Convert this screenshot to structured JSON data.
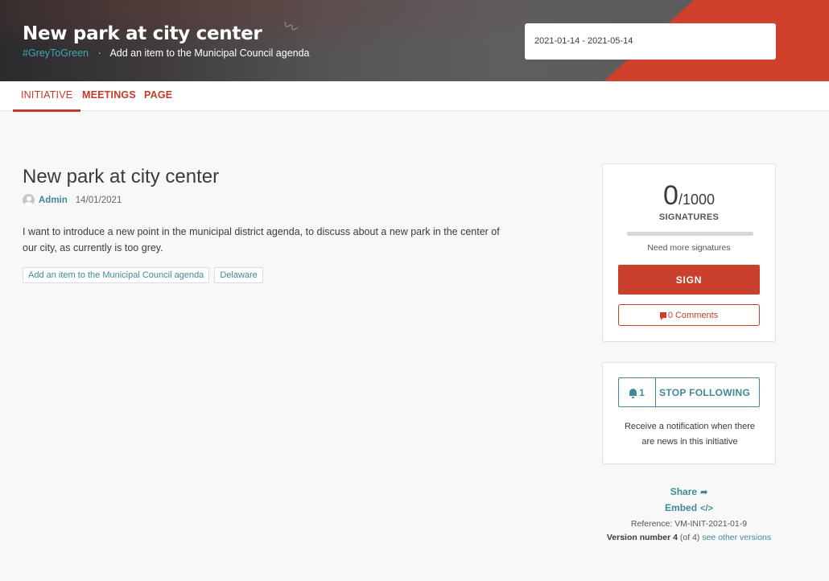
{
  "hero": {
    "title": "New park at city center",
    "hashtag": "#GreyToGreen",
    "separator": "·",
    "type": "Add an item to the Municipal Council agenda",
    "dates": "2021-01-14 - 2021-05-14"
  },
  "tabs": [
    {
      "label": "INITIATIVE",
      "active": true
    },
    {
      "label": "MEETINGS",
      "active": false
    },
    {
      "label": "PAGE",
      "active": false
    }
  ],
  "main": {
    "title": "New park at city center",
    "author": "Admin",
    "date": "14/01/2021",
    "description": "I want to introduce a new point in the municipal district agenda, to discuss about a new park in the center of our city, as currently is too grey.",
    "tags": [
      "Add an item to the Municipal Council agenda",
      "Delaware"
    ]
  },
  "signatures": {
    "count": "0",
    "total": "/1000",
    "label": "SIGNATURES",
    "progress": 0,
    "need_more": "Need more signatures",
    "sign_label": "SIGN",
    "comments_label": "0 Comments"
  },
  "follow": {
    "followers": "1",
    "button_label": "STOP FOLLOWING",
    "note": "Receive a notification when there are news in this initiative"
  },
  "extras": {
    "share_label": "Share",
    "embed_label": "Embed",
    "reference": "Reference: VM-INIT-2021-01-9",
    "version_label": "Version number 4",
    "version_of": "(of 4)",
    "see_versions": "see other versions"
  },
  "colors": {
    "accent": "#c9402d",
    "link": "#3f8a96"
  }
}
